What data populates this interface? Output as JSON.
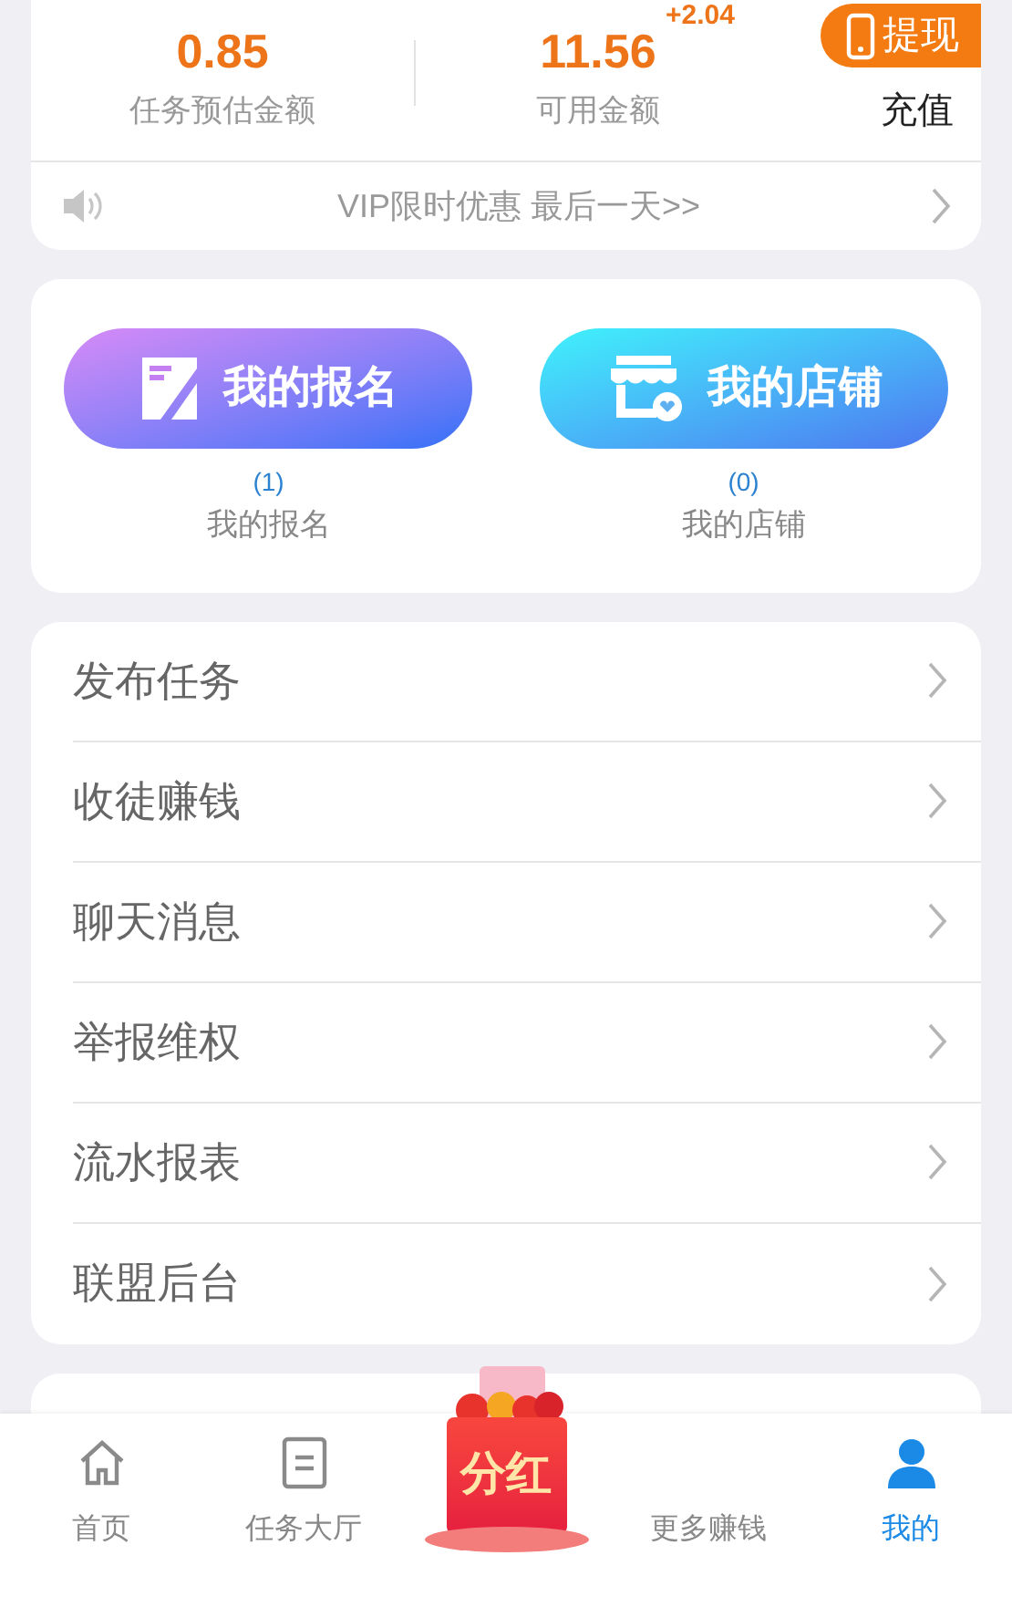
{
  "balance": {
    "estimate": {
      "value": "0.85",
      "label": "任务预估金额"
    },
    "available": {
      "value": "11.56",
      "delta": "+2.04",
      "label": "可用金额"
    },
    "withdraw_button": "提现",
    "recharge_link": "充值"
  },
  "notice": {
    "text": "VIP限时优惠 最后一天>>"
  },
  "shortcuts": [
    {
      "button": "我的报名",
      "kind": "signup",
      "count": "(1)",
      "label": "我的报名"
    },
    {
      "button": "我的店铺",
      "kind": "shop",
      "count": "(0)",
      "label": "我的店铺"
    }
  ],
  "menu": [
    "发布任务",
    "收徒赚钱",
    "聊天消息",
    "举报维权",
    "流水报表",
    "联盟后台"
  ],
  "tab_bar": [
    {
      "label": "首页",
      "kind": "home",
      "selected": false
    },
    {
      "label": "任务大厅",
      "kind": "tasks",
      "selected": false
    },
    {
      "label": "分红",
      "kind": "promo",
      "selected": false
    },
    {
      "label": "更多赚钱",
      "kind": "more",
      "selected": false
    },
    {
      "label": "我的",
      "kind": "me",
      "selected": true
    }
  ]
}
